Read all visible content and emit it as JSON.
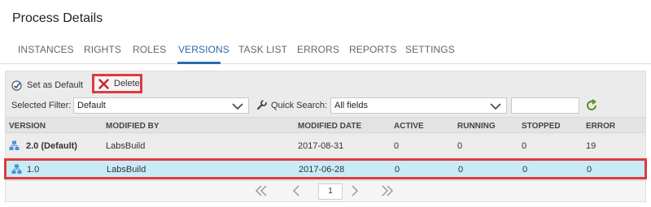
{
  "page": {
    "title": "Process Details"
  },
  "tabs": [
    "INSTANCES",
    "RIGHTS",
    "ROLES",
    "VERSIONS",
    "TASK LIST",
    "ERRORS",
    "REPORTS",
    "SETTINGS"
  ],
  "active_tab": "VERSIONS",
  "toolbar": {
    "set_default_label": "Set as Default",
    "delete_label": "Delete"
  },
  "filter": {
    "selected_filter_label": "Selected Filter:",
    "selected_filter_value": "Default",
    "quick_search_label": "Quick Search:",
    "quick_search_field": "All fields",
    "quick_search_text": ""
  },
  "grid": {
    "headers": [
      "VERSION",
      "MODIFIED BY",
      "MODIFIED DATE",
      "ACTIVE",
      "RUNNING",
      "STOPPED",
      "ERROR"
    ],
    "rows": [
      {
        "version": "2.0 (Default)",
        "modified_by": "LabsBuild",
        "modified_date": "2017-08-31",
        "active": "0",
        "running": "0",
        "stopped": "0",
        "error": "19"
      },
      {
        "version": "1.0",
        "modified_by": "LabsBuild",
        "modified_date": "2017-06-28",
        "active": "0",
        "running": "0",
        "stopped": "0",
        "error": "0"
      }
    ]
  },
  "pager": {
    "page": "1"
  },
  "colors": {
    "accent": "#2a6ab3",
    "highlight": "#e03a3e",
    "selected_row": "#c8ecf7",
    "refresh": "#5a8f1e"
  }
}
